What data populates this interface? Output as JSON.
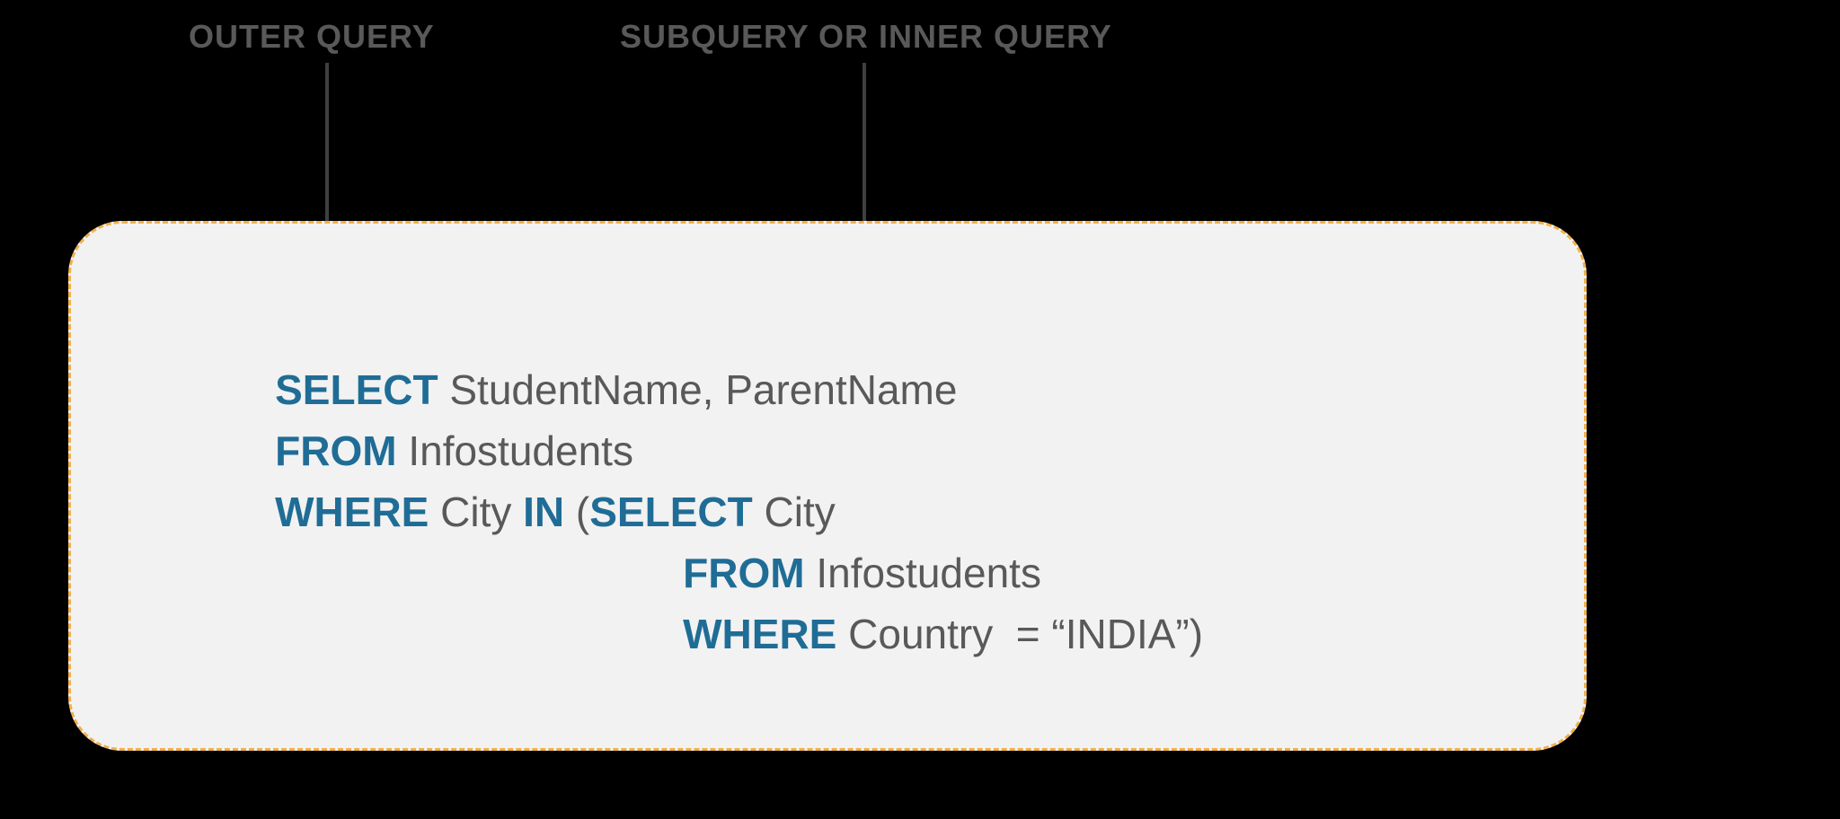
{
  "labels": {
    "outer": "OUTER QUERY",
    "inner": "SUBQUERY OR INNER QUERY"
  },
  "code": {
    "line1": {
      "kw_select": "SELECT",
      "rest": " StudentName, ParentName"
    },
    "line2": {
      "kw_from": "FROM",
      "rest": " Infostudents"
    },
    "line3": {
      "kw_where": "WHERE",
      "mid": " City ",
      "kw_in": "IN",
      "paren": " (",
      "kw_select2": "SELECT",
      "rest": " City"
    },
    "line4": {
      "kw_from": "FROM",
      "rest": " Infostudents"
    },
    "line5": {
      "kw_where": "WHERE",
      "rest": " Country  = “INDIA”)"
    }
  }
}
